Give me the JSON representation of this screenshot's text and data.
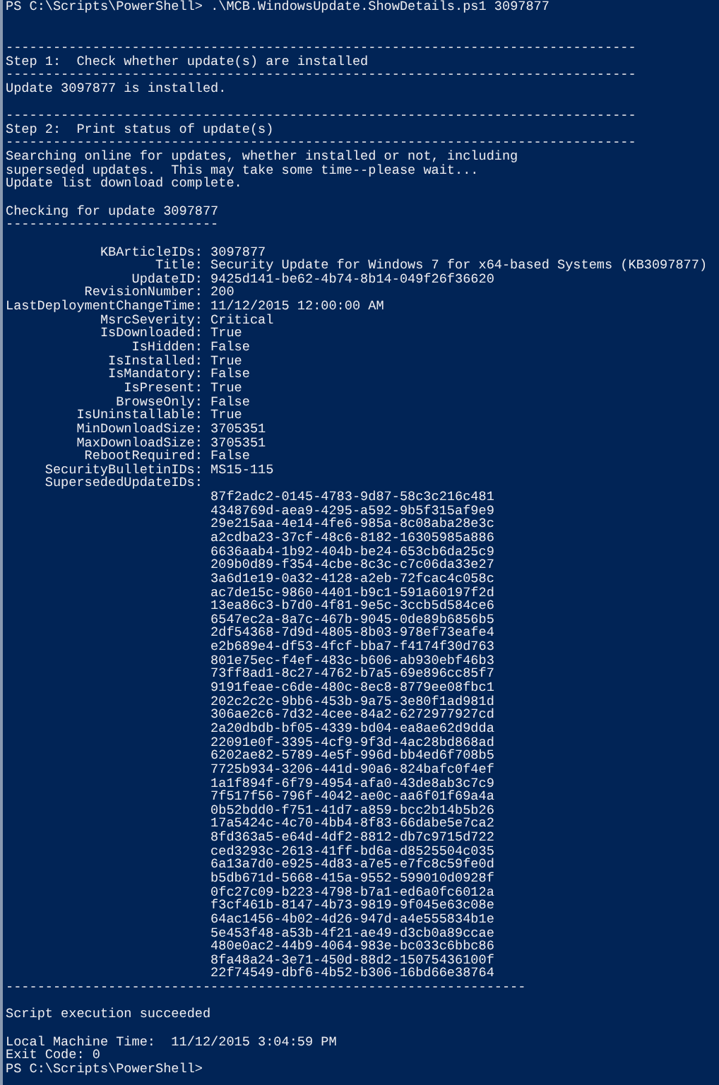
{
  "lines": [
    {
      "kind": "prompt",
      "prompt": "PS C:\\Scripts\\PowerShell>",
      "command": ".\\MCB.WindowsUpdate.ShowDetails.ps1 3097877"
    },
    {
      "kind": "blank"
    },
    {
      "kind": "blank"
    },
    {
      "kind": "rule",
      "text": "--------------------------------------------------------------------------------"
    },
    {
      "kind": "text",
      "text": "Step 1:  Check whether update(s) are installed"
    },
    {
      "kind": "rule",
      "text": "--------------------------------------------------------------------------------"
    },
    {
      "kind": "text",
      "text": "Update 3097877 is installed."
    },
    {
      "kind": "blank"
    },
    {
      "kind": "rule",
      "text": "--------------------------------------------------------------------------------"
    },
    {
      "kind": "text",
      "text": "Step 2:  Print status of update(s)"
    },
    {
      "kind": "rule",
      "text": "--------------------------------------------------------------------------------"
    },
    {
      "kind": "text",
      "text": "Searching online for updates, whether installed or not, including"
    },
    {
      "kind": "text",
      "text": "superseded updates.  This may take some time--please wait..."
    },
    {
      "kind": "text",
      "text": "Update list download complete."
    },
    {
      "kind": "blank"
    },
    {
      "kind": "text",
      "text": "Checking for update 3097877"
    },
    {
      "kind": "rule",
      "text": "---------------------------"
    },
    {
      "kind": "blank"
    },
    {
      "kind": "property",
      "key": "KBArticleIDs:",
      "value": "3097877"
    },
    {
      "kind": "property",
      "key": "Title:",
      "value": "Security Update for Windows 7 for x64-based Systems (KB3097877)"
    },
    {
      "kind": "property",
      "key": "UpdateID:",
      "value": "9425d141-be62-4b74-8b14-049f26f36620"
    },
    {
      "kind": "property",
      "key": "RevisionNumber:",
      "value": "200"
    },
    {
      "kind": "property",
      "key": "LastDeploymentChangeTime:",
      "value": "11/12/2015 12:00:00 AM"
    },
    {
      "kind": "property",
      "key": "MsrcSeverity:",
      "value": "Critical"
    },
    {
      "kind": "property",
      "key": "IsDownloaded:",
      "value": "True"
    },
    {
      "kind": "property",
      "key": "IsHidden:",
      "value": "False"
    },
    {
      "kind": "property",
      "key": "IsInstalled:",
      "value": "True"
    },
    {
      "kind": "property",
      "key": "IsMandatory:",
      "value": "False"
    },
    {
      "kind": "property",
      "key": "IsPresent:",
      "value": "True"
    },
    {
      "kind": "property",
      "key": "BrowseOnly:",
      "value": "False"
    },
    {
      "kind": "property",
      "key": "IsUninstallable:",
      "value": "True"
    },
    {
      "kind": "property",
      "key": "MinDownloadSize:",
      "value": "3705351"
    },
    {
      "kind": "property",
      "key": "MaxDownloadSize:",
      "value": "3705351"
    },
    {
      "kind": "property",
      "key": "RebootRequired:",
      "value": "False"
    },
    {
      "kind": "property",
      "key": "SecurityBulletinIDs:",
      "value": "MS15-115"
    },
    {
      "kind": "property",
      "key": "SupersededUpdateIDs:"
    },
    {
      "kind": "item",
      "text": "87f2adc2-0145-4783-9d87-58c3c216c481"
    },
    {
      "kind": "item",
      "text": "4348769d-aea9-4295-a592-9b5f315af9e9"
    },
    {
      "kind": "item",
      "text": "29e215aa-4e14-4fe6-985a-8c08aba28e3c"
    },
    {
      "kind": "item",
      "text": "a2cdba23-37cf-48c6-8182-16305985a886"
    },
    {
      "kind": "item",
      "text": "6636aab4-1b92-404b-be24-653cb6da25c9"
    },
    {
      "kind": "item",
      "text": "209b0d89-f354-4cbe-8c3c-c7c06da33e27"
    },
    {
      "kind": "item",
      "text": "3a6d1e19-0a32-4128-a2eb-72fcac4c058c"
    },
    {
      "kind": "item",
      "text": "ac7de15c-9860-4401-b9c1-591a60197f2d"
    },
    {
      "kind": "item",
      "text": "13ea86c3-b7d0-4f81-9e5c-3ccb5d584ce6"
    },
    {
      "kind": "item",
      "text": "6547ec2a-8a7c-467b-9045-0de89b6856b5"
    },
    {
      "kind": "item",
      "text": "2df54368-7d9d-4805-8b03-978ef73eafe4"
    },
    {
      "kind": "item",
      "text": "e2b689e4-df53-4fcf-bba7-f4174f30d763"
    },
    {
      "kind": "item",
      "text": "801e75ec-f4ef-483c-b606-ab930ebf46b3"
    },
    {
      "kind": "item",
      "text": "73ff8ad1-8c27-4762-b7a5-69e896cc85f7"
    },
    {
      "kind": "item",
      "text": "9191feae-c6de-480c-8ec8-8779ee08fbc1"
    },
    {
      "kind": "item",
      "text": "202c2c2c-9bb6-453b-9a75-3e80f1ad981d"
    },
    {
      "kind": "item",
      "text": "306ae2c6-7d32-4cee-84a2-6272977927cd"
    },
    {
      "kind": "item",
      "text": "2a20dbdb-bf05-4339-bd04-ea8ae62d9dda"
    },
    {
      "kind": "item",
      "text": "22091e0f-3395-4cf9-9f3d-4ac28bd868ad"
    },
    {
      "kind": "item",
      "text": "6202ae82-5789-4e5f-996d-bb4ed6f708b5"
    },
    {
      "kind": "item",
      "text": "7725b934-3206-441d-90a6-824bafc0f4ef"
    },
    {
      "kind": "item",
      "text": "1a1f894f-6f79-4954-afa0-43de8ab3c7c9"
    },
    {
      "kind": "item",
      "text": "7f517f56-796f-4042-ae0c-aa6f01f69a4a"
    },
    {
      "kind": "item",
      "text": "0b52bdd0-f751-41d7-a859-bcc2b14b5b26"
    },
    {
      "kind": "item",
      "text": "17a5424c-4c70-4bb4-8f83-66dabe5e7ca2"
    },
    {
      "kind": "item",
      "text": "8fd363a5-e64d-4df2-8812-db7c9715d722"
    },
    {
      "kind": "item",
      "text": "ced3293c-2613-41ff-bd6a-d8525504c035"
    },
    {
      "kind": "item",
      "text": "6a13a7d0-e925-4d83-a7e5-e7fc8c59fe0d"
    },
    {
      "kind": "item",
      "text": "b5db671d-5668-415a-9552-599010d0928f"
    },
    {
      "kind": "item",
      "text": "0fc27c09-b223-4798-b7a1-ed6a0fc6012a"
    },
    {
      "kind": "item",
      "text": "f3cf461b-8147-4b73-9819-9f045e63c08e"
    },
    {
      "kind": "item",
      "text": "64ac1456-4b02-4d26-947d-a4e555834b1e"
    },
    {
      "kind": "item",
      "text": "5e453f48-a53b-4f21-ae49-d3cb0a89ccae"
    },
    {
      "kind": "item",
      "text": "480e0ac2-44b9-4064-983e-bc033c6bbc86"
    },
    {
      "kind": "item",
      "text": "8fa48a24-3e71-450d-88d2-15075436100f"
    },
    {
      "kind": "item",
      "text": "22f74549-dbf6-4b52-b306-16bd66e38764"
    },
    {
      "kind": "rule",
      "text": "------------------------------------------------------------------"
    },
    {
      "kind": "blank"
    },
    {
      "kind": "text",
      "text": "Script execution succeeded"
    },
    {
      "kind": "blank"
    },
    {
      "kind": "text",
      "text": "Local Machine Time:  11/12/2015 3:04:59 PM"
    },
    {
      "kind": "text",
      "text": "Exit Code: 0"
    },
    {
      "kind": "prompt",
      "prompt": "PS C:\\Scripts\\PowerShell>"
    }
  ]
}
